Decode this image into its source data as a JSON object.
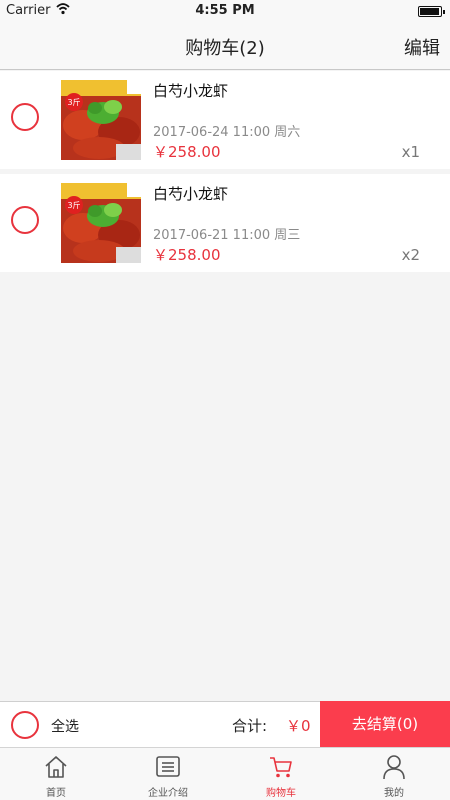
{
  "status": {
    "carrier": "Carrier",
    "time": "4:55 PM"
  },
  "nav": {
    "title": "购物车(2)",
    "edit": "编辑"
  },
  "cart": {
    "items": [
      {
        "name": "白芍小龙虾",
        "datetime": "2017-06-24 11:00 周六",
        "price": "￥258.00",
        "qty": "x1",
        "thumb_badge": "3斤"
      },
      {
        "name": "白芍小龙虾",
        "datetime": "2017-06-21 11:00 周三",
        "price": "￥258.00",
        "qty": "x2",
        "thumb_badge": "3斤"
      }
    ]
  },
  "checkout": {
    "select_all": "全选",
    "total_label": "合计:",
    "total_value": "￥0",
    "submit": "去结算(0)"
  },
  "tabs": [
    {
      "label": "首页",
      "icon": "home-icon"
    },
    {
      "label": "企业介绍",
      "icon": "document-list-icon"
    },
    {
      "label": "购物车",
      "icon": "cart-icon"
    },
    {
      "label": "我的",
      "icon": "user-icon"
    }
  ],
  "colors": {
    "accent": "#e8333d",
    "checkout_button": "#fb3d4d"
  }
}
